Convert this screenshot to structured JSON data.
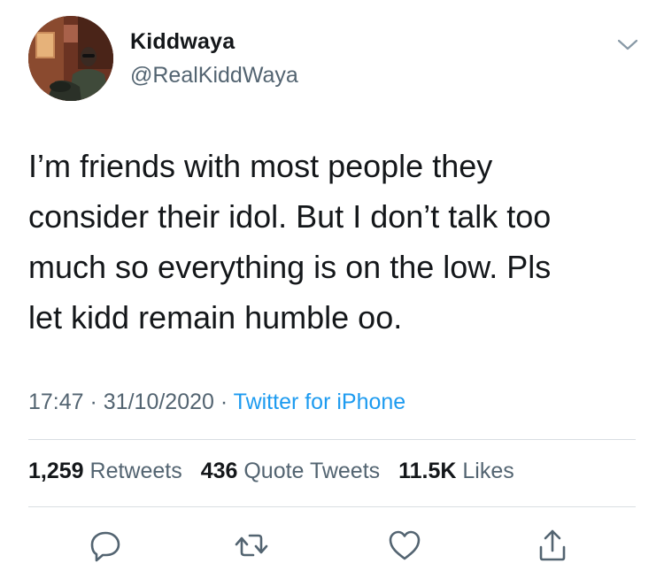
{
  "author": {
    "display_name": "Kiddwaya",
    "handle": "@RealKiddWaya"
  },
  "tweet": {
    "text": "I’m friends with most people they\nconsider their idol. But I don’t talk too\nmuch so everything is on the low. Pls\nlet kidd remain humble oo.",
    "time": "17:47",
    "separator": " · ",
    "date": "31/10/2020",
    "source": "Twitter for iPhone"
  },
  "stats": {
    "retweets_count": "1,259",
    "retweets_label": "Retweets",
    "quotes_count": "436",
    "quotes_label": "Quote Tweets",
    "likes_count": "11.5K",
    "likes_label": "Likes"
  },
  "icons": {
    "menu": "chevron-down-icon",
    "reply": "reply-icon",
    "retweet": "retweet-icon",
    "like": "heart-icon",
    "share": "share-icon"
  },
  "colors": {
    "text": "#14171a",
    "secondary": "#536471",
    "link": "#1d9bf0",
    "divider": "#d9dee2",
    "icon": "#536471"
  }
}
